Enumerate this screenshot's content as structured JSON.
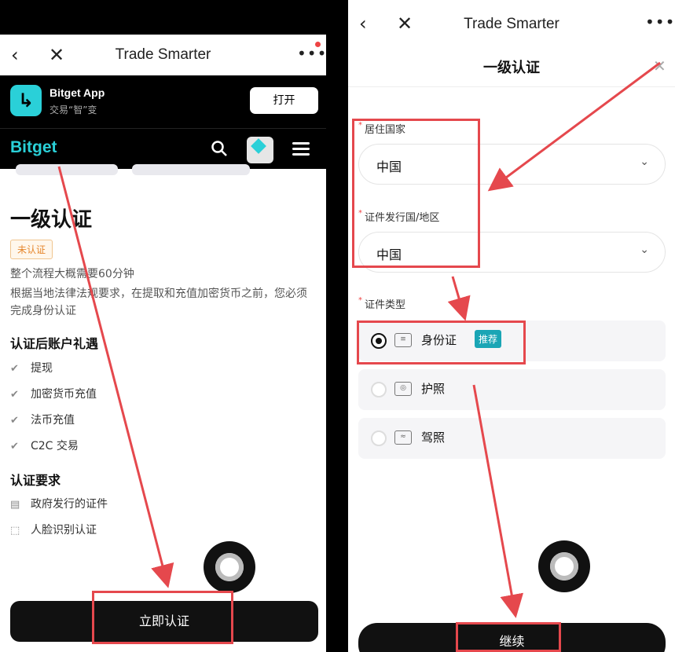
{
  "left": {
    "nav": {
      "title": "Trade Smarter",
      "back_icon": "chevron-left-icon",
      "close_icon": "close-icon",
      "more_icon": "more-icon"
    },
    "app_banner": {
      "name": "Bitget App",
      "subtitle": "交易“智”变",
      "open_label": "打开"
    },
    "brand": {
      "name": "Bitget"
    },
    "page": {
      "title": "一级认证",
      "status_badge": "未认证",
      "duration_text": "整个流程大概需要60分钟",
      "notice_text": "根据当地法律法规要求，在提取和充值加密货币之前，您必须完成身份认证",
      "benefits_title": "认证后账户礼遇",
      "benefits": [
        "提现",
        "加密货币充值",
        "法币充值",
        "C2C 交易"
      ],
      "requirements_title": "认证要求",
      "requirements": [
        "政府发行的证件",
        "人脸识别认证"
      ],
      "cta_label": "立即认证"
    }
  },
  "right": {
    "nav": {
      "title": "Trade Smarter"
    },
    "sheet_title": "一级认证",
    "fields": {
      "residence_label": "居住国家",
      "residence_value": "中国",
      "issuer_label": "证件发行国/地区",
      "issuer_value": "中国",
      "doc_type_label": "证件类型"
    },
    "doc_options": [
      {
        "label": "身份证",
        "badge": "推荐",
        "selected": true
      },
      {
        "label": "护照",
        "selected": false
      },
      {
        "label": "驾照",
        "selected": false
      }
    ],
    "cta_label": "继续"
  },
  "colors": {
    "brand_accent": "#2ad0d8",
    "annotation_red": "#e5484d",
    "badge_orange": "#e6862c",
    "recommend_teal": "#1aa5b5"
  }
}
